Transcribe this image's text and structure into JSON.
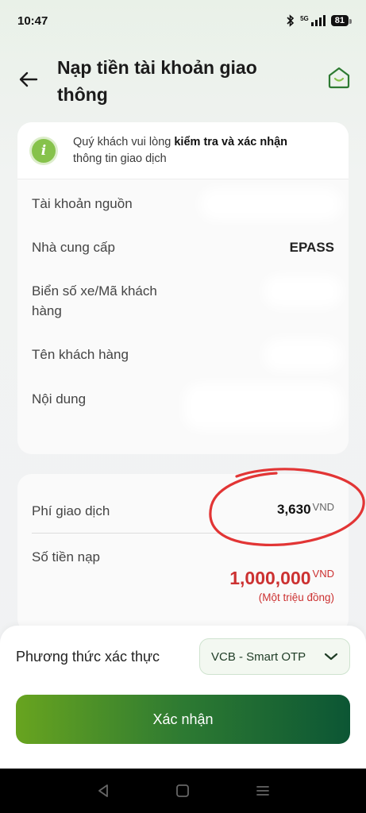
{
  "status_bar": {
    "time": "10:47",
    "network": "5G",
    "battery": "81"
  },
  "header": {
    "title": "Nạp tiền tài khoản giao thông"
  },
  "notice": {
    "text_prefix": "Quý khách vui lòng ",
    "text_bold": "kiểm tra và xác nhận",
    "text_suffix": " thông tin giao dịch"
  },
  "details": {
    "source_account_label": "Tài khoản nguồn",
    "provider_label": "Nhà cung cấp",
    "provider_value": "EPASS",
    "plate_label": "Biển số xe/Mã khách hàng",
    "customer_name_label": "Tên khách hàng",
    "content_label": "Nội dung"
  },
  "fees": {
    "fee_label": "Phí giao dịch",
    "fee_value": "3,630",
    "fee_currency": "VND",
    "amount_label": "Số tiền nạp",
    "amount_value": "1,000,000",
    "amount_currency": "VND",
    "amount_words": "(Một triệu đồng)"
  },
  "auth": {
    "label": "Phương thức xác thực",
    "selected": "VCB - Smart OTP"
  },
  "confirm_button": "Xác nhận",
  "colors": {
    "brand_green": "#2d7a32",
    "amount_red": "#cc3131",
    "annotation_red": "#e23535"
  }
}
